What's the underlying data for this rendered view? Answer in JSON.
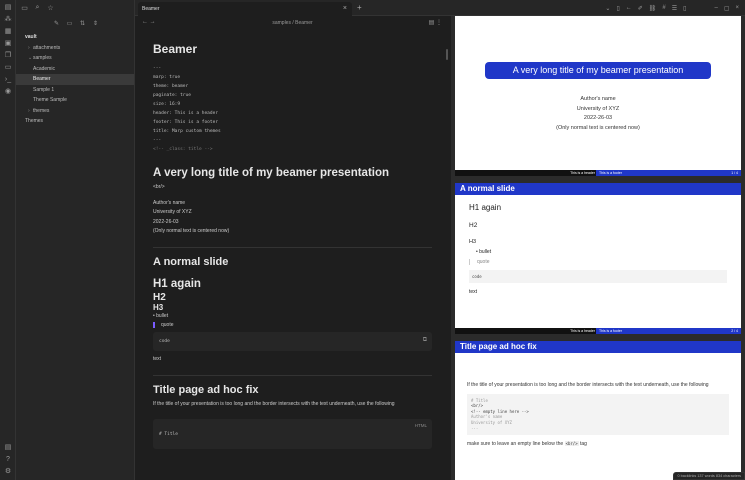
{
  "ribbon": {
    "icons": [
      "files-icon",
      "graph-icon",
      "canvas-icon",
      "calendar-icon",
      "pages-icon",
      "templates-icon",
      "terminal-icon",
      "publish-icon"
    ],
    "bottom_icons": [
      "help-icon",
      "settings-icon",
      "vault-icon"
    ]
  },
  "tab": {
    "title": "Beamer"
  },
  "breadcrumb": "samples / Beamer",
  "tree": {
    "vault": "vault",
    "items": [
      {
        "label": "attachments",
        "folder": true,
        "level": 1
      },
      {
        "label": "samples",
        "folder": true,
        "level": 1,
        "open": true
      },
      {
        "label": "Academic",
        "level": 2
      },
      {
        "label": "Beamer",
        "level": 2,
        "selected": true
      },
      {
        "label": "Sample 1",
        "level": 2
      },
      {
        "label": "Theme Sample",
        "level": 2
      },
      {
        "label": "themes",
        "folder": true,
        "level": 1
      },
      {
        "label": "Themes",
        "level": 0
      }
    ]
  },
  "editor": {
    "title": "Beamer",
    "frontmatter": [
      "---",
      "marp: true",
      "theme: beamer",
      "paginate: true",
      "size: 16:9",
      "header: This is a header",
      "footer: This is a footer",
      "title: Marp custom themes",
      "---"
    ],
    "comment": "<!-- _class: title -->",
    "title_h1": "A very long title of my beamer presentation",
    "br": "<br/>",
    "author_lines": [
      "Author's name",
      "University of XYZ",
      "2022-26-03",
      "(Only normal text is centered now)"
    ],
    "slide2_h1": "A normal slide",
    "h1_again": "H1 again",
    "h2": "H2",
    "h3": "H3",
    "bullet": "• bullet",
    "quote": "quote",
    "code": "code",
    "text": "text",
    "slide3_h1": "Title page ad hoc fix",
    "slide3_p": "If the title of your presentation is too long and the border intersects with the text underneath, use the following",
    "code_lang": "HTML",
    "code_line": "# Title"
  },
  "preview": {
    "s1_title": "A very long title of my beamer presentation",
    "s1_lines": [
      "Author's name",
      "University of XYZ",
      "2022-26-03",
      "(Only normal text is centered now)"
    ],
    "header": "This is a header",
    "footer": "This is a footer",
    "page1": "1 / 4",
    "page2": "2 / 4",
    "s2_title": "A normal slide",
    "s2_h1": "H1 again",
    "s2_h2": "H2",
    "s2_h3": "H3",
    "s2_bullet": "bullet",
    "s2_quote": "quote",
    "s2_code": "code",
    "s2_text": "text",
    "s3_title": "Title page ad hoc fix",
    "s3_p": "If the title of your presentation is too long and the border intersects with the text underneath, use the following",
    "s3_code": [
      "# Title",
      "<br/>",
      "<!-- empty line here -->",
      "Author's name",
      "University of XYZ",
      "..."
    ],
    "s3_p2_a": "make sure to leave an empty line below the ",
    "s3_p2_code": "<br/>",
    "s3_p2_b": " tag"
  },
  "status": "0 backlinks   137 words  834 characters"
}
